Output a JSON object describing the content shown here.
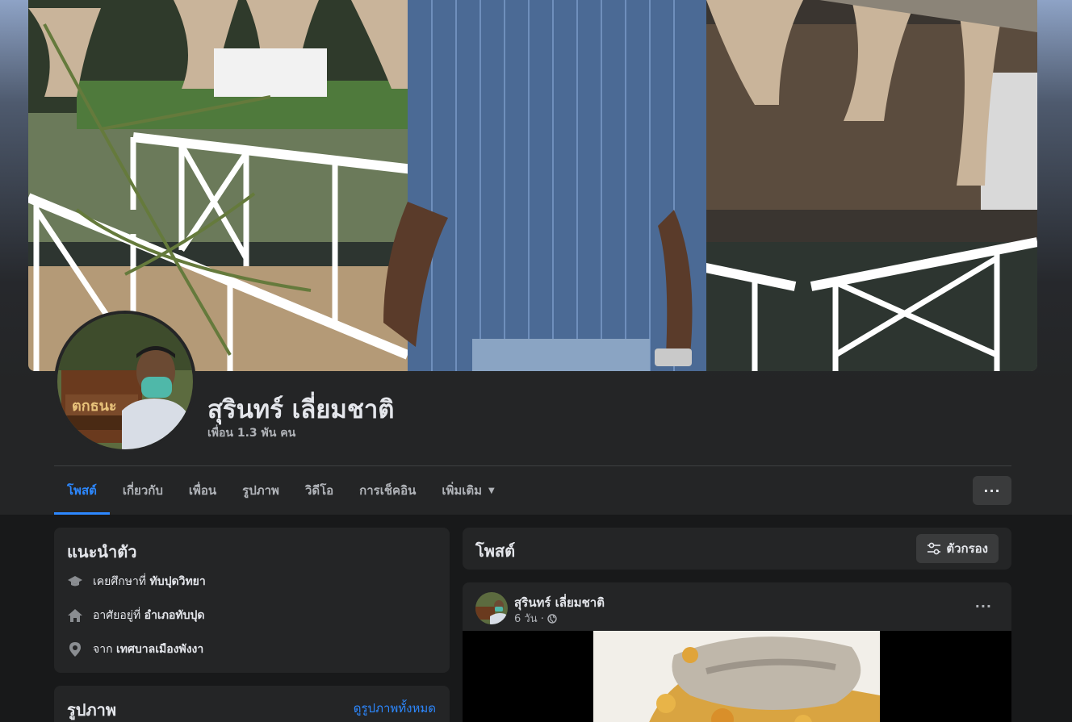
{
  "profile": {
    "name": "สุรินทร์ เลี่ยมชาติ",
    "friends": "เพื่อน 1.3 พัน คน"
  },
  "tabs": [
    {
      "label": "โพสต์",
      "active": true
    },
    {
      "label": "เกี่ยวกับ"
    },
    {
      "label": "เพื่อน"
    },
    {
      "label": "รูปภาพ"
    },
    {
      "label": "วิดีโอ"
    },
    {
      "label": "การเช็คอิน"
    },
    {
      "label": "เพิ่มเติม"
    }
  ],
  "more_button": "···",
  "intro": {
    "title": "แนะนำตัว",
    "items": [
      {
        "icon": "graduation-cap-icon",
        "prefix": "เคยศึกษาที่ ",
        "value": "ทับปุดวิทยา"
      },
      {
        "icon": "home-icon",
        "prefix": "อาศัยอยู่ที่ ",
        "value": "อำเภอทับปุด"
      },
      {
        "icon": "location-pin-icon",
        "prefix": "จาก ",
        "value": "เทศบาลเมืองพังงา"
      }
    ]
  },
  "photos": {
    "title": "รูปภาพ",
    "see_all": "ดูรูปภาพทั้งหมด"
  },
  "posts_section": {
    "title": "โพสต์",
    "filter_label": "ตัวกรอง"
  },
  "post": {
    "author": "สุรินทร์ เลี่ยมชาติ",
    "time": "6 วัน ·",
    "privacy_icon": "globe-icon",
    "more": "···"
  },
  "colors": {
    "accent": "#2d88ff",
    "background": "#18191a",
    "card": "#242526",
    "button": "#3a3b3c"
  }
}
